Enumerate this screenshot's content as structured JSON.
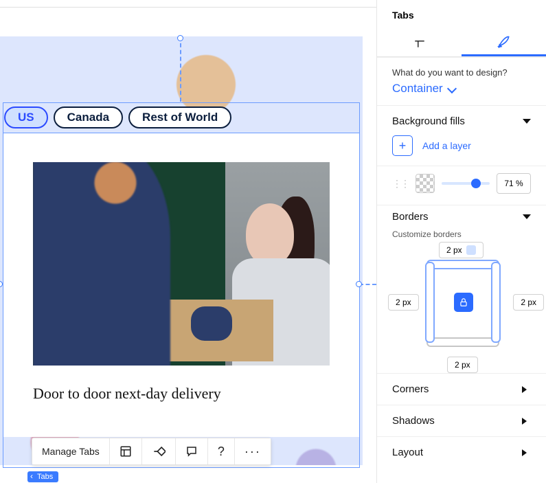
{
  "canvas": {
    "tabs": [
      {
        "label": "US",
        "active": true
      },
      {
        "label": "Canada",
        "active": false
      },
      {
        "label": "Rest of World",
        "active": false
      }
    ],
    "caption": "Door to door next-day delivery",
    "toolbar": {
      "manage_label": "Manage Tabs"
    },
    "badge": "Tabs"
  },
  "panel": {
    "title": "Tabs",
    "mode_tabs": {
      "layout_active": false,
      "design_active": true
    },
    "design_question": "What do you want to design?",
    "design_target": "Container",
    "sections": {
      "background_fills": {
        "title": "Background fills",
        "expanded": true,
        "add_layer": "Add a layer",
        "opacity_percent": 71,
        "opacity_display": "71 %"
      },
      "borders": {
        "title": "Borders",
        "expanded": true,
        "subtitle": "Customize borders",
        "top": "2 px",
        "right": "2 px",
        "bottom": "2 px",
        "left": "2 px",
        "locked": true,
        "preview_color": "#cfe0ff"
      },
      "corners": {
        "title": "Corners",
        "expanded": false
      },
      "shadows": {
        "title": "Shadows",
        "expanded": false
      },
      "layout": {
        "title": "Layout",
        "expanded": false
      }
    }
  }
}
